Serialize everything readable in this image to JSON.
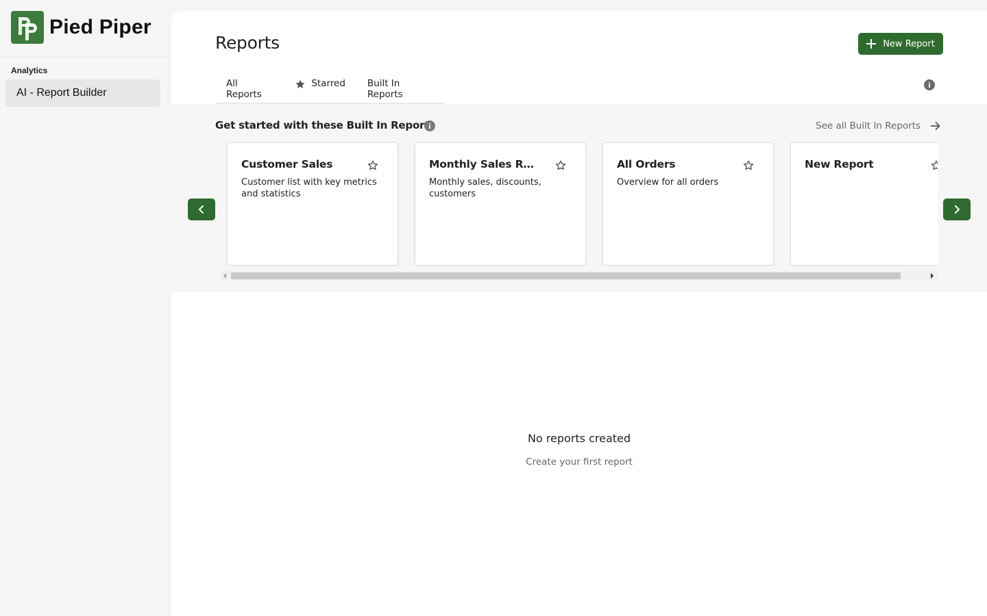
{
  "brand": {
    "name": "Pied Piper",
    "logo_text": "PP",
    "logo_color": "#3d7a3d"
  },
  "sidebar": {
    "section_label": "Analytics",
    "items": [
      {
        "label": "AI - Report Builder",
        "active": true
      }
    ]
  },
  "header": {
    "title": "Reports",
    "new_report_label": "New Report"
  },
  "tabs": [
    {
      "label": "All Reports"
    },
    {
      "label": "Starred",
      "icon": "star-filled-icon"
    },
    {
      "label": "Built In Reports"
    }
  ],
  "builtin": {
    "title": "Get started with these Built In Reports",
    "see_all_label": "See all Built In Reports",
    "cards": [
      {
        "title": "Customer Sales",
        "description": "Customer list with key metrics and statistics",
        "starred": false
      },
      {
        "title": "Monthly Sales Report",
        "description": "Monthly sales, discounts, customers",
        "starred": false
      },
      {
        "title": "All Orders",
        "description": "Overview for all orders",
        "starred": false
      },
      {
        "title": "New Report",
        "description": "",
        "starred": false
      }
    ]
  },
  "empty_state": {
    "title": "No reports created",
    "subtitle": "Create your first report"
  },
  "colors": {
    "accent": "#2f6b2f",
    "sidebar_bg": "#f5f5f5",
    "active_item_bg": "#e6e6e6"
  }
}
